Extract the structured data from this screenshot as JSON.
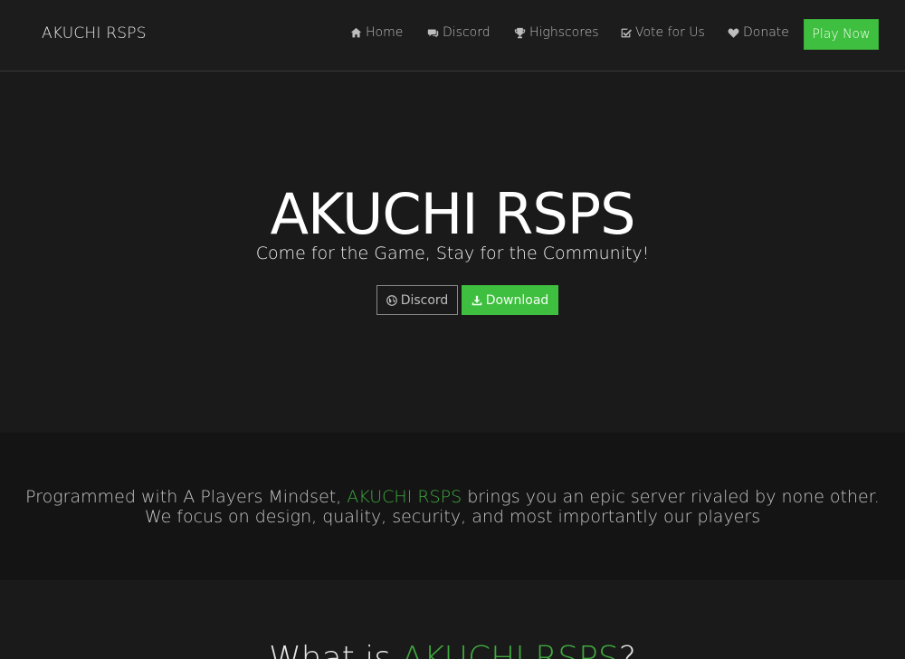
{
  "navbar": {
    "brand": "AKUCHI RSPS",
    "items": [
      {
        "label": "Home",
        "icon": "home-icon"
      },
      {
        "label": "Discord",
        "icon": "comments-icon"
      },
      {
        "label": "Highscores",
        "icon": "trophy-icon"
      },
      {
        "label": "Vote for Us",
        "icon": "check-square-icon"
      },
      {
        "label": "Donate",
        "icon": "heart-icon"
      }
    ],
    "cta": "Play Now"
  },
  "hero": {
    "title": "AKUCHI RSPS",
    "subtitle": "Come for the Game, Stay for the Community!",
    "discord_label": "Discord",
    "download_label": "Download"
  },
  "band": {
    "line1_prefix": "Programmed with A Players Mindset,",
    "line1_accent": "AKUCHI RSPS",
    "line1_suffix": "brings you an epic server rivaled by none other.",
    "line2": "We focus on design, quality, security, and most importantly our players"
  },
  "what": {
    "prefix": "What is",
    "accent": "AKUCHI RSPS",
    "suffix": "?"
  },
  "colors": {
    "accent": "#3fbf3f",
    "background": "#1a1a1a"
  }
}
